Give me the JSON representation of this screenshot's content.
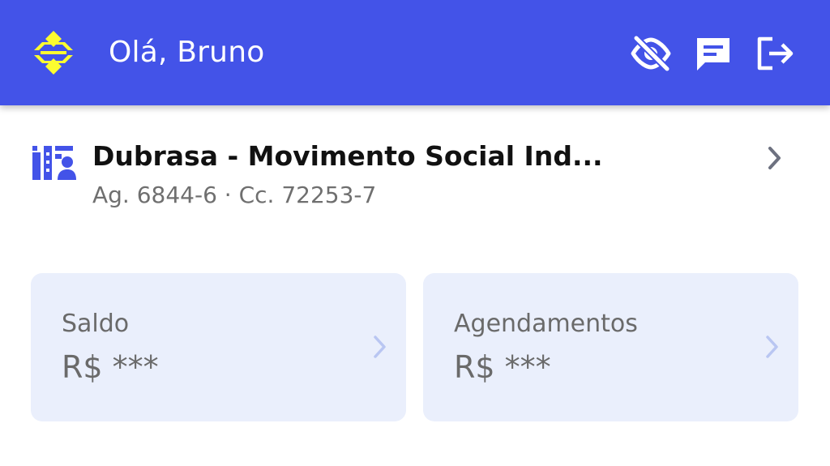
{
  "header": {
    "greeting": "Olá, Bruno",
    "background_color": "#4353e8",
    "logo_icon": "banco-do-brasil-logo",
    "logo_color": "#fcfc30",
    "actions": [
      {
        "icon": "eye-off-icon",
        "name": "hide-values-button"
      },
      {
        "icon": "chat-icon",
        "name": "messages-button"
      },
      {
        "icon": "logout-icon",
        "name": "logout-button"
      }
    ]
  },
  "account": {
    "name": "Dubrasa - Movimento Social Ind...",
    "details": "Ag. 6844-6 · Cc. 72253-7",
    "icon": "company-account-icon",
    "icon_color": "#4353e8"
  },
  "cards": {
    "saldo": {
      "label": "Saldo",
      "value": "R$ ***"
    },
    "agendamentos": {
      "label": "Agendamentos",
      "value": "R$ ***"
    },
    "background_color": "#eaeffc",
    "chevron_color": "#b9c6f2"
  }
}
